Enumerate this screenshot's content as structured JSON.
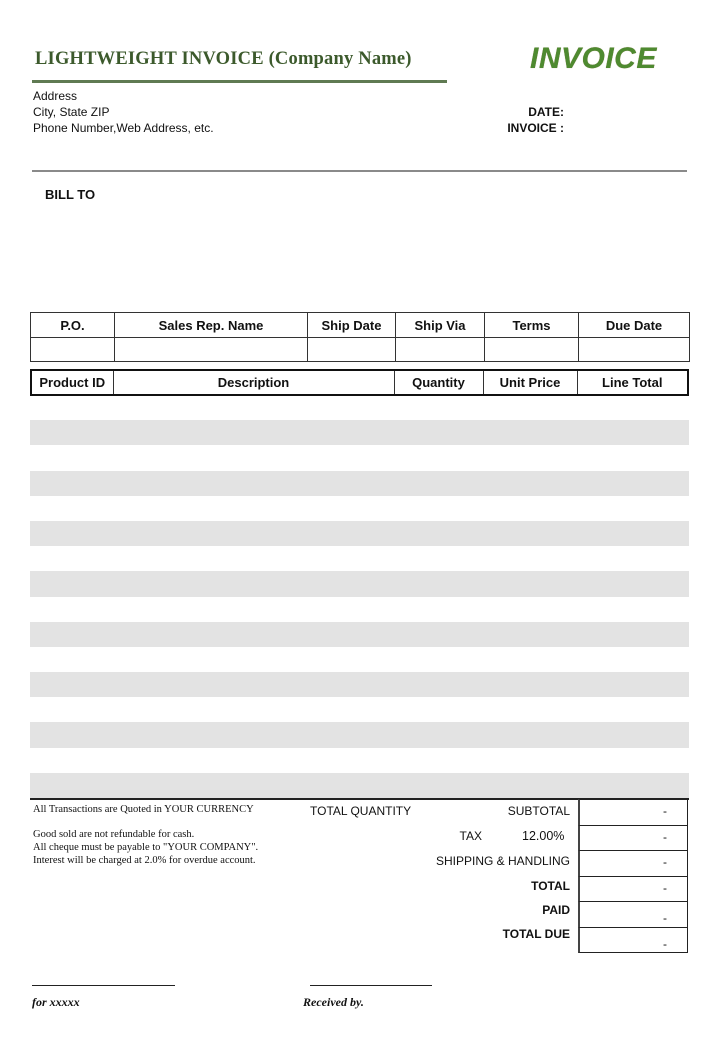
{
  "header": {
    "company_title": "LIGHTWEIGHT INVOICE (Company Name)",
    "invoice_title": "INVOICE",
    "address_lines": [
      "Address",
      "City, State ZIP",
      "Phone Number,Web Address, etc."
    ],
    "date_label": "DATE:",
    "invoice_label": "INVOICE :",
    "date_value": "",
    "invoice_value": ""
  },
  "bill_to": {
    "label": "BILL TO",
    "value": ""
  },
  "order_info": {
    "columns": [
      "P.O.",
      "Sales Rep. Name",
      "Ship Date",
      "Ship Via",
      "Terms",
      "Due Date"
    ],
    "values": [
      "",
      "",
      "",
      "",
      "",
      ""
    ]
  },
  "line_items": {
    "columns": [
      "Product ID",
      "Description",
      "Quantity",
      "Unit Price",
      "Line Total"
    ],
    "row_count": 16,
    "rows": []
  },
  "notes": {
    "currency_note": "All Transactions are Quoted in YOUR CURRENCY",
    "terms": [
      "Good sold are not refundable  for cash.",
      "All cheque must be payable to \"YOUR COMPANY\".",
      "Interest will be charged at 2.0% for overdue account."
    ]
  },
  "totals": {
    "total_quantity_label": "TOTAL QUANTITY",
    "subtotal_label": "SUBTOTAL",
    "tax_label": "TAX",
    "tax_rate": "12.00%",
    "shipping_label": "SHIPPING & HANDLING",
    "total_label": "TOTAL",
    "paid_label": "PAID",
    "total_due_label": "TOTAL DUE",
    "subtotal_value": "-",
    "tax_value": "-",
    "shipping_value": "-",
    "total_value": "-",
    "paid_value": "-",
    "total_due_value": "-"
  },
  "signatures": {
    "left": "for xxxxx",
    "right": "Received by."
  },
  "colors": {
    "title_green": "#3c5a2c",
    "invoice_green": "#4e8a30",
    "row_shade": "#e3e3e3"
  }
}
